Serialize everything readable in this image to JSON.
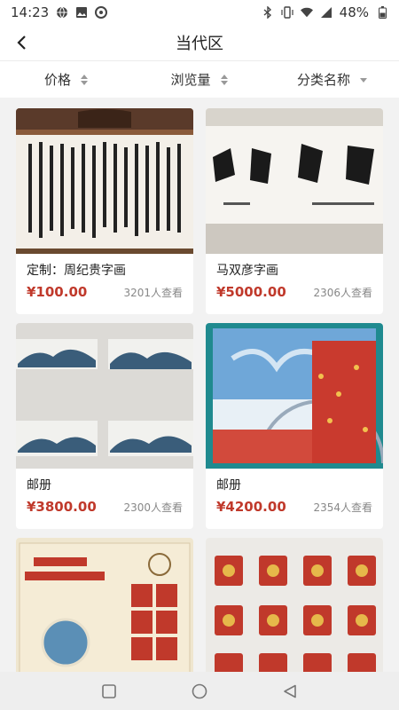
{
  "status_bar": {
    "time": "14:23",
    "battery": "48%"
  },
  "header": {
    "title": "当代区"
  },
  "filters": [
    {
      "label": "价格"
    },
    {
      "label": "浏览量"
    },
    {
      "label": "分类名称"
    }
  ],
  "products": [
    {
      "title": "定制：周纪贵字画",
      "price": "¥100.00",
      "views": "3201人查看"
    },
    {
      "title": "马双彦字画",
      "price": "¥5000.00",
      "views": "2306人查看"
    },
    {
      "title": "邮册",
      "price": "¥3800.00",
      "views": "2300人查看"
    },
    {
      "title": "邮册",
      "price": "¥4200.00",
      "views": "2354人查看"
    }
  ],
  "colors": {
    "price": "#c0392b",
    "background": "#f2f2f2"
  }
}
